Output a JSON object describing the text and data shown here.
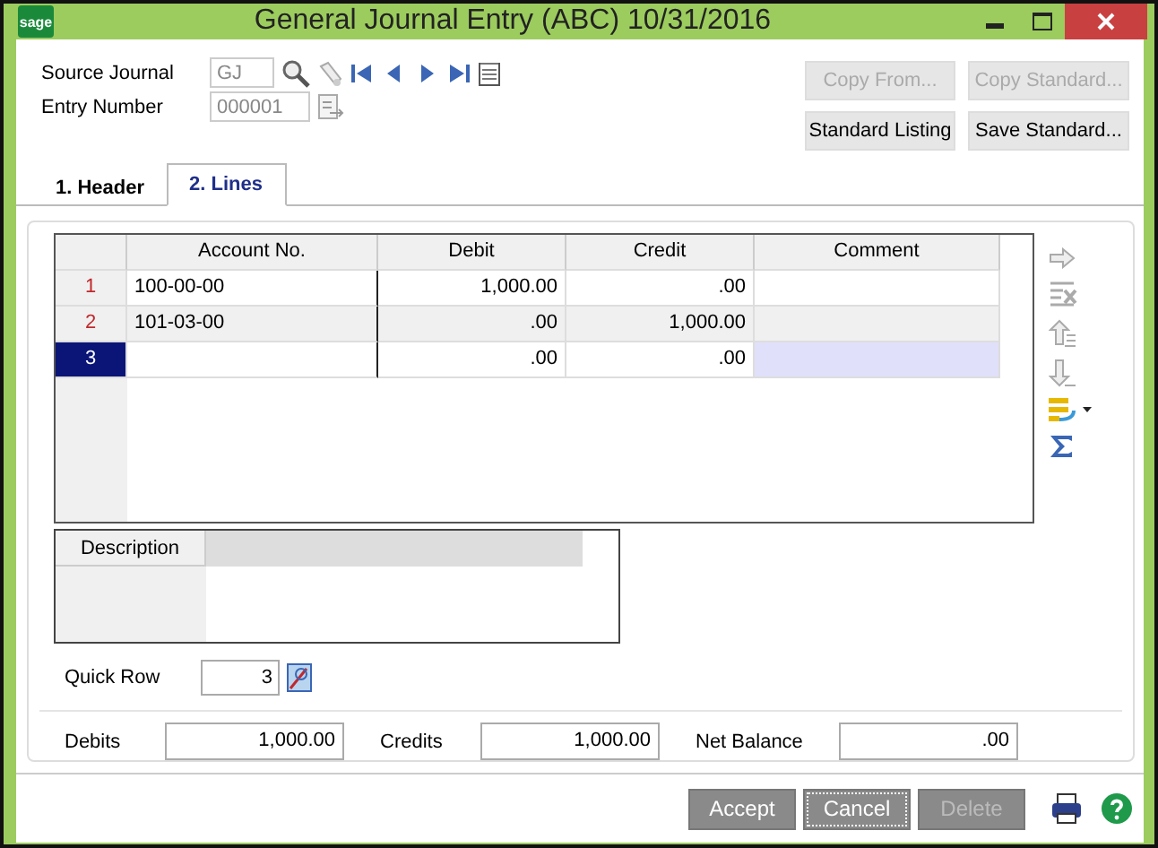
{
  "window": {
    "logo": "sage",
    "title": "General Journal Entry (ABC) 10/31/2016"
  },
  "fields": [
    {
      "label": "Source Journal",
      "value": "GJ",
      "disabled": true
    },
    {
      "label": "Entry Number",
      "value": "000001",
      "disabled": true
    }
  ],
  "top_buttons": [
    {
      "label": "Copy From...",
      "disabled": true
    },
    {
      "label": "Copy Standard...",
      "disabled": true
    },
    {
      "label": "Standard Listing",
      "disabled": false
    },
    {
      "label": "Save Standard...",
      "disabled": false
    }
  ],
  "tabs": [
    {
      "label": "1. Header",
      "selected": false
    },
    {
      "label": "2. Lines",
      "selected": true
    }
  ],
  "table": {
    "columns": [
      "Account No.",
      "Debit",
      "Credit",
      "Comment"
    ],
    "rows": [
      {
        "number": "1",
        "selected": false,
        "cells": [
          "100-00-00",
          "1,000.00",
          ".00",
          ""
        ]
      },
      {
        "number": "2",
        "selected": false,
        "cells": [
          "101-03-00",
          ".00",
          "1,000.00",
          ""
        ]
      },
      {
        "number": "3",
        "selected": true,
        "cells": [
          "",
          ".00",
          ".00",
          ""
        ]
      }
    ]
  },
  "description": {
    "label": "Description"
  },
  "quick_row": {
    "label": "Quick Row",
    "value": "3"
  },
  "totals": [
    {
      "label": "Debits",
      "value": "1,000.00"
    },
    {
      "label": "Credits",
      "value": "1,000.00"
    },
    {
      "label": "Net Balance",
      "value": ".00"
    }
  ],
  "footer_buttons": [
    {
      "label": "Accept",
      "disabled": false
    },
    {
      "label": "Cancel",
      "disabled": false
    },
    {
      "label": "Delete",
      "disabled": true
    }
  ]
}
